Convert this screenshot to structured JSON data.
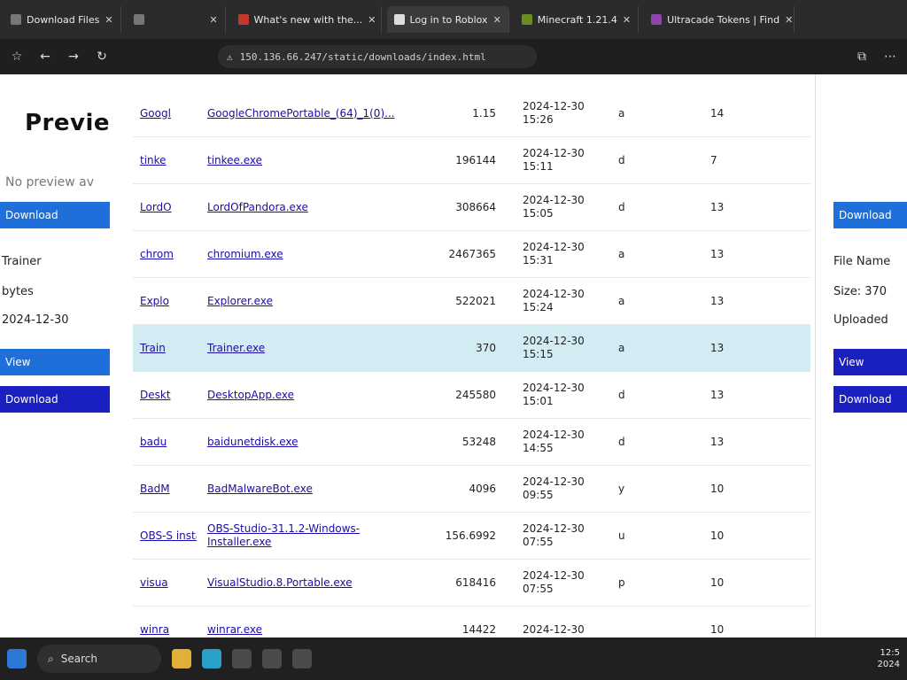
{
  "tabs": [
    {
      "label": "Download Files",
      "active": false
    },
    {
      "label": "",
      "active": false
    },
    {
      "label": "What's new with the...",
      "active": false
    },
    {
      "label": "Log in to Roblox",
      "active": false
    },
    {
      "label": "Minecraft 1.21.4",
      "active": false
    },
    {
      "label": "Ultracade Tokens | Find",
      "active": false
    }
  ],
  "address": {
    "url": "150.136.66.247/static/downloads/index.html"
  },
  "left_panel": {
    "title": "Previe",
    "no_preview": "No preview av",
    "download_label": "Download",
    "trainer_label": "Trainer",
    "size_label": "bytes",
    "date_label": "2024-12-30",
    "view_label": "View"
  },
  "right_panel": {
    "name_label": "File Name",
    "size_label": "Size: 370",
    "uploaded_label": "Uploaded",
    "view_label": "View",
    "download_label": "Download"
  },
  "rows": [
    {
      "short": "Googl",
      "name": "GoogleChromePortable_(64)_1(0)...",
      "size": "1.15",
      "date": "2024-12-30 15:26",
      "type": "a",
      "num": "14"
    },
    {
      "short": "tinke",
      "name": "tinkee.exe",
      "size": "196144",
      "date": "2024-12-30 15:11",
      "type": "d",
      "num": "7"
    },
    {
      "short": "LordO",
      "name": "LordOfPandora.exe",
      "size": "308664",
      "date": "2024-12-30 15:05",
      "type": "d",
      "num": "13"
    },
    {
      "short": "chrom",
      "name": "chromium.exe",
      "size": "2467365",
      "date": "2024-12-30 15:31",
      "type": "a",
      "num": "13"
    },
    {
      "short": "Explo",
      "name": "Explorer.exe",
      "size": "522021",
      "date": "2024-12-30 15:24",
      "type": "a",
      "num": "13"
    },
    {
      "short": "Train",
      "name": "Trainer.exe",
      "size": "370",
      "date": "2024-12-30 15:15",
      "type": "a",
      "num": "13",
      "selected": true
    },
    {
      "short": "Deskt",
      "name": "DesktopApp.exe",
      "size": "245580",
      "date": "2024-12-30 15:01",
      "type": "d",
      "num": "13"
    },
    {
      "short": "badu",
      "name": "baidunetdisk.exe",
      "size": "53248",
      "date": "2024-12-30 14:55",
      "type": "d",
      "num": "13"
    },
    {
      "short": "BadM",
      "name": "BadMalwareBot.exe",
      "size": "4096",
      "date": "2024-12-30 09:55",
      "type": "y",
      "num": "10"
    },
    {
      "short": "OBS-S install",
      "name": "OBS-Studio-31.1.2-Windows-Installer.exe",
      "size": "156.6992",
      "date": "2024-12-30 07:55",
      "type": "u",
      "num": "10"
    },
    {
      "short": "visua",
      "name": "VisualStudio.8.Portable.exe",
      "size": "618416",
      "date": "2024-12-30 07:55",
      "type": "p",
      "num": "10"
    },
    {
      "short": "winra",
      "name": "winrar.exe",
      "size": "14422",
      "date": "2024-12-30",
      "type": "",
      "num": "10"
    }
  ],
  "taskbar": {
    "search_label": "Search",
    "time": "12:5",
    "date": "2024"
  }
}
